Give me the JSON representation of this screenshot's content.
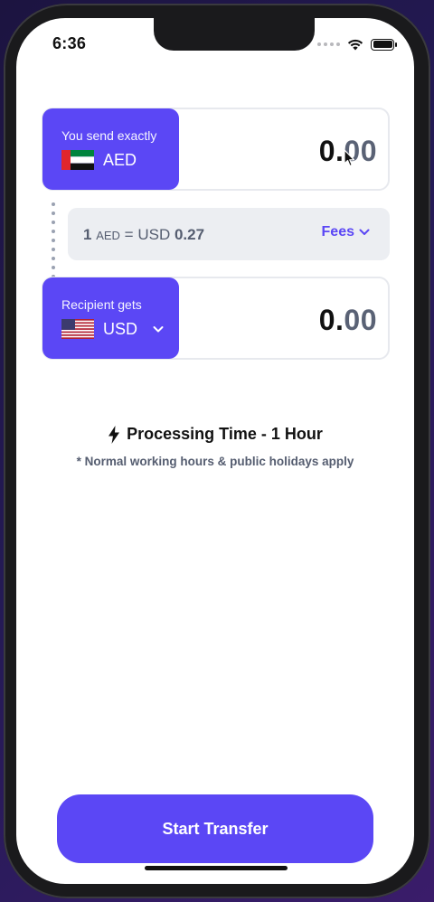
{
  "status_bar": {
    "time": "6:36"
  },
  "send": {
    "label": "You send exactly",
    "currency": "AED",
    "flag_icon": "uae-flag-icon",
    "amount_int": "0.",
    "amount_dec": "00"
  },
  "rate": {
    "base_amount": "1",
    "base_currency": "AED",
    "equals": "= USD",
    "quote": "0.27",
    "fees_label": "Fees"
  },
  "receive": {
    "label": "Recipient gets",
    "currency": "USD",
    "flag_icon": "us-flag-icon",
    "amount_int": "0.",
    "amount_dec": "00"
  },
  "processing": {
    "title": "Processing Time - 1 Hour",
    "note": "* Normal working hours & public holidays apply"
  },
  "cta": {
    "label": "Start Transfer"
  },
  "colors": {
    "accent": "#5b47f5",
    "muted_text": "#555d70",
    "rate_bg": "#eceef2"
  }
}
